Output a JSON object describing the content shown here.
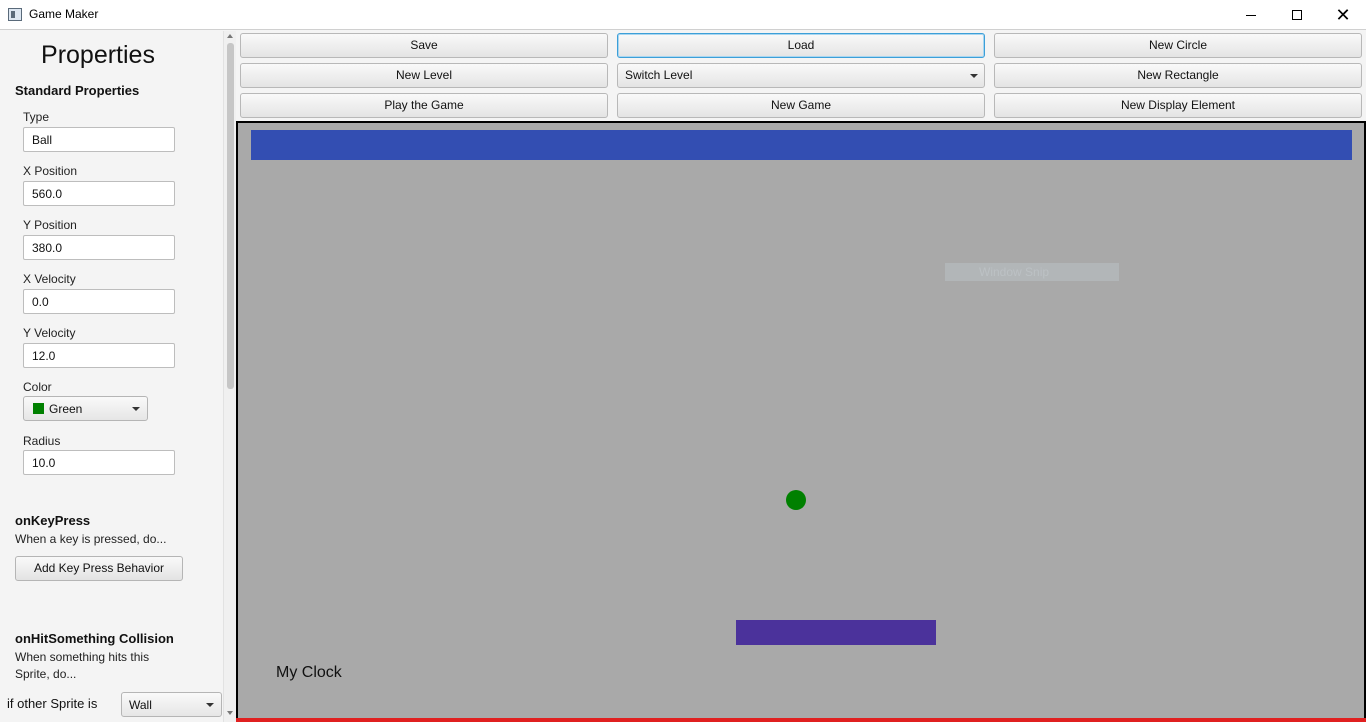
{
  "window": {
    "title": "Game Maker"
  },
  "properties": {
    "title": "Properties",
    "standard_heading": "Standard Properties",
    "fields": [
      {
        "label": "Type",
        "value": "Ball"
      },
      {
        "label": "X Position",
        "value": "560.0"
      },
      {
        "label": "Y Position",
        "value": "380.0"
      },
      {
        "label": "X Velocity",
        "value": "0.0"
      },
      {
        "label": "Y Velocity",
        "value": "12.0"
      }
    ],
    "color": {
      "label": "Color",
      "value": "Green",
      "swatch": "#008000"
    },
    "radius": {
      "label": "Radius",
      "value": "10.0"
    },
    "on_key_press": {
      "heading": "onKeyPress",
      "description": "When a key is pressed, do...",
      "button_label": "Add Key Press Behavior"
    },
    "on_hit": {
      "heading": "onHitSomething Collision",
      "description_line1": "When something hits this",
      "description_line2": "Sprite, do...",
      "condition_label": "if other Sprite is",
      "condition_value": "Wall"
    }
  },
  "toolbar": {
    "save": "Save",
    "load": "Load",
    "new_circle": "New Circle",
    "new_level": "New Level",
    "switch_level": "Switch Level",
    "new_rectangle": "New Rectangle",
    "play_game": "Play the Game",
    "new_game": "New Game",
    "new_display_element": "New Display Element"
  },
  "canvas": {
    "background": "#a9a9a9",
    "ghost_label": "Window Snip",
    "clock_text": "My Clock",
    "colors": {
      "bar": "#334eb2",
      "ball": "#008000",
      "paddle": "#4b329b"
    }
  }
}
